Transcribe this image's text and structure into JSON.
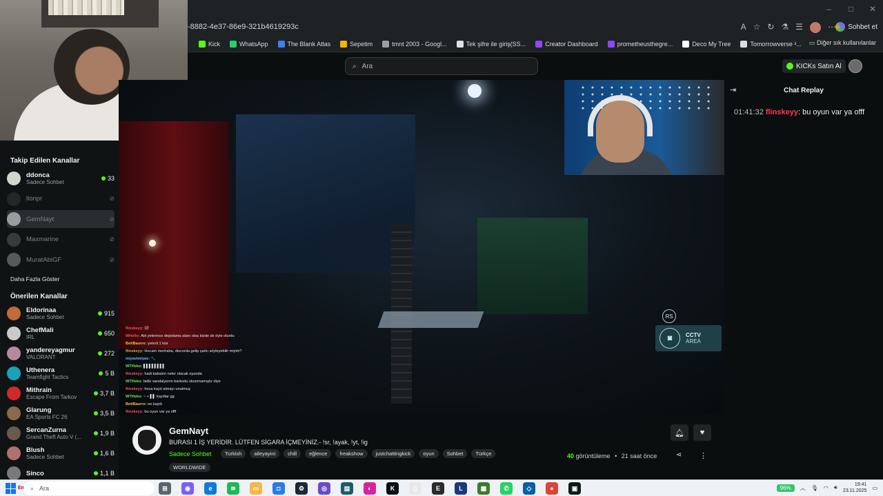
{
  "browser": {
    "url": "-8882-4e37-86e9-321b4619293c",
    "window_controls": [
      "–",
      "□",
      "✕"
    ],
    "sohbet_label": "Sohbet et",
    "bookmarks": [
      {
        "label": "Kick",
        "color": "#53fc18"
      },
      {
        "label": "WhatsApp",
        "color": "#25d366"
      },
      {
        "label": "The Blank Atlas",
        "color": "#3b82f6"
      },
      {
        "label": "Sepetim",
        "color": "#f5b400"
      },
      {
        "label": "tmnt 2003 - Googl...",
        "color": "#9aa0a6"
      },
      {
        "label": "Tek şifre ile giriş(SS...",
        "color": "#e0e0e0"
      },
      {
        "label": "Creator Dashboard",
        "color": "#9146ff"
      },
      {
        "label": "prometheusthegre...",
        "color": "#9146ff"
      },
      {
        "label": "Deco My Tree",
        "color": "#ffffff"
      },
      {
        "label": "Tomorrowverse -...",
        "color": "#dddddd"
      }
    ],
    "bookmarks_more": "Diğer sık kullanılanlar"
  },
  "header": {
    "search_placeholder": "Ara",
    "kicks_button": "KICKs Satın Al"
  },
  "sidebar": {
    "followed_title": "Takip Edilen Kanallar",
    "followed": [
      {
        "name": "ddonca",
        "category": "Sadece Sohbet",
        "viewers": "33",
        "live": true,
        "avatar": "#cfd8cf"
      },
      {
        "name": "llonpr",
        "live": false,
        "avatar": "#333"
      },
      {
        "name": "GemNayt",
        "live": false,
        "avatar": "#e8e8e8",
        "selected": true
      },
      {
        "name": "Maxmarine",
        "live": false,
        "avatar": "#555"
      },
      {
        "name": "MuratAbiGF",
        "live": false,
        "avatar": "#888"
      }
    ],
    "show_more": "Daha Fazla Göster",
    "recommended_title": "Önerilen Kanallar",
    "recommended": [
      {
        "name": "Eldorinaa",
        "category": "Sadece Sohbet",
        "viewers": "915",
        "avatar": "#c46a3a"
      },
      {
        "name": "ChefMali",
        "category": "IRL",
        "viewers": "650",
        "avatar": "#c9c9c9"
      },
      {
        "name": "yandereyagmur",
        "category": "VALORANT",
        "viewers": "272",
        "avatar": "#b58aa0"
      },
      {
        "name": "Uthenera",
        "category": "Teamfight Tactics",
        "viewers": "5 B",
        "avatar": "#1aa3b8"
      },
      {
        "name": "Mithrain",
        "category": "Escape From Tarkov",
        "viewers": "3,7 B",
        "avatar": "#d02a2a"
      },
      {
        "name": "Glarung",
        "category": "EA Sports FC 26",
        "viewers": "3,5 B",
        "avatar": "#8a6a4a"
      },
      {
        "name": "SercanZurna",
        "category": "Grand Theft Auto V (...",
        "viewers": "1,9 B",
        "avatar": "#6a5a4a"
      },
      {
        "name": "Blush",
        "category": "Sadece Sohbet",
        "viewers": "1,6 B",
        "avatar": "#b07070"
      },
      {
        "name": "Sinco",
        "category": "",
        "viewers": "1,1 B",
        "avatar": "#7a7a7a"
      }
    ]
  },
  "video": {
    "rs_label": "RS",
    "cctv_title": "CCTV",
    "cctv_sub": "AREA",
    "overlay_chat": [
      {
        "user": "flinskeyy:",
        "msg": "🚭",
        "color": "#ff4d5e"
      },
      {
        "user": "WHello:",
        "msg": "Abi yeterince depolama alanı olsa bizde de öyle olurdu",
        "color": "#ff4d5e"
      },
      {
        "user": "BetiBaurre:",
        "msg": "yeterli 1 kisi",
        "color": "#f5c542"
      },
      {
        "user": "flinskeyy:",
        "msg": "Hocam merhaba, discorda gelip şarkı söyleyebilir miyim?",
        "color": "#f5a142"
      },
      {
        "user": "miyavimiyav:",
        "msg": "🐾",
        "color": "#7ab8ff"
      },
      {
        "user": "WTHeko:",
        "msg": "▌▌▌▌▌▌▌▌",
        "color": "#7fe05a"
      },
      {
        "user": "flinskeyy:",
        "msg": "hadi bakalım neler olacak oyunda",
        "color": "#ff4d5e"
      },
      {
        "user": "WTHeko:",
        "msg": "belki sandalyenin barkodu okunmamıştır diye",
        "color": "#7fe05a"
      },
      {
        "user": "flinskeyy:",
        "msg": "hoca kayıt almayı unutmuş",
        "color": "#ff4d5e"
      },
      {
        "user": "WTHeko:",
        "msg": "~ + ▌▌ kayıtlar gg",
        "color": "#7fe05a"
      },
      {
        "user": "BetiBaurre:",
        "msg": "ne kaydı",
        "color": "#f5c542"
      },
      {
        "user": "flinskeyy:",
        "msg": "bu oyun var ya offf",
        "color": "#ff4d5e"
      }
    ]
  },
  "chat": {
    "title": "Chat Replay",
    "messages": [
      {
        "time": "01:41:32",
        "user": "flinskeyy",
        "text": "bu oyun var ya offf"
      }
    ]
  },
  "stream_info": {
    "channel": "GemNayt",
    "title": "BURASI 1 İŞ YERİDİR. LÜTFEN SİGARA İÇMEYİNİZ.- !sr, !ayak, !yt, !ig",
    "category": "Sadece Sohbet",
    "tags": [
      "Turkish",
      "aileyayini",
      "chill",
      "eğlence",
      "freakshow",
      "justchattingkick",
      "oyun",
      "Sohbet",
      "Türkçe"
    ],
    "extra_tag": "WORLDWIDE",
    "views_count": "40",
    "views_label": "görüntüleme",
    "time_ago": "21 saat önce"
  },
  "taskbar": {
    "search_placeholder": "Ara",
    "start_label": "Emi",
    "battery": "96%",
    "time": "19:41",
    "date": "23.11.2025",
    "apps": [
      {
        "name": "task-view-icon",
        "color": "#5a6470",
        "glyph": "⊞"
      },
      {
        "name": "copilot-app-icon",
        "color": "#7c5cff",
        "glyph": "◉"
      },
      {
        "name": "edge-icon",
        "color": "#0f7bd8",
        "glyph": "e"
      },
      {
        "name": "spotify-icon",
        "color": "#1db954",
        "glyph": "≋"
      },
      {
        "name": "folder-icon",
        "color": "#f2b84b",
        "glyph": "▭"
      },
      {
        "name": "store-icon",
        "color": "#2a7de1",
        "glyph": "◘"
      },
      {
        "name": "steam-icon",
        "color": "#1b2838",
        "glyph": "⚙"
      },
      {
        "name": "obs-icon",
        "color": "#6b4bc8",
        "glyph": "◎"
      },
      {
        "name": "capcut-icon",
        "color": "#1c5d68",
        "glyph": "▤"
      },
      {
        "name": "instagram-icon",
        "color": "#d6249f",
        "glyph": "◐"
      },
      {
        "name": "kick-app-icon",
        "color": "#0b0e0f",
        "glyph": "K"
      },
      {
        "name": "file-icon",
        "color": "#e8e8e8",
        "glyph": "▯"
      },
      {
        "name": "epic-icon",
        "color": "#2b2b2b",
        "glyph": "E"
      },
      {
        "name": "lol-icon",
        "color": "#1a3a7a",
        "glyph": "L"
      },
      {
        "name": "minecraft-icon",
        "color": "#3a7d2a",
        "glyph": "▦"
      },
      {
        "name": "whatsapp-app-icon",
        "color": "#25d366",
        "glyph": "✆"
      },
      {
        "name": "vscode-icon",
        "color": "#0a5fa8",
        "glyph": "◇"
      },
      {
        "name": "chrome-icon",
        "color": "#db4437",
        "glyph": "●"
      },
      {
        "name": "kick-app-icon-2",
        "color": "#0e1a12",
        "glyph": "▣"
      }
    ]
  }
}
